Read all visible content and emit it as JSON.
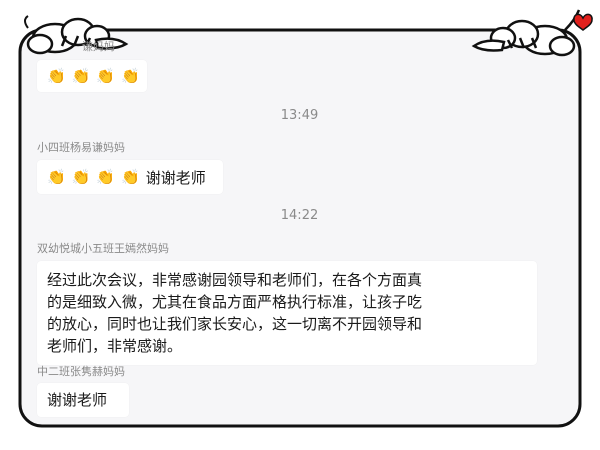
{
  "chat": {
    "messages": [
      {
        "sender": "谦妈妈",
        "emoji": [
          "👏",
          "👏",
          "👏",
          "👏"
        ],
        "text": ""
      },
      {
        "time": "13:49"
      },
      {
        "sender": "小四班杨易谦妈妈",
        "emoji": [
          "👏",
          "👏",
          "👏",
          "👏"
        ],
        "text": "谢谢老师"
      },
      {
        "time": "14:22"
      },
      {
        "sender": "双幼悦城小五班王嫣然妈妈",
        "lines": [
          "经过此次会议，非常感谢园领导和老师们，在各个方面真",
          "的是细致入微，尤其在食品方面严格执行标准，让孩子吃",
          "的放心，同时也让我们家长安心，这一切离不开园领导和",
          "老师们，非常感谢。"
        ]
      },
      {
        "sender": "中二班张隽赫妈妈",
        "text": "谢谢老师"
      }
    ]
  },
  "icons": {
    "clap": "clapping-hands-emoji",
    "heart": "heart-icon"
  },
  "colors": {
    "background": "#f6f6f8",
    "frame": "#111111",
    "heart": "#e0201c",
    "text": "#1a1a1a",
    "meta": "#8a8a8a"
  }
}
